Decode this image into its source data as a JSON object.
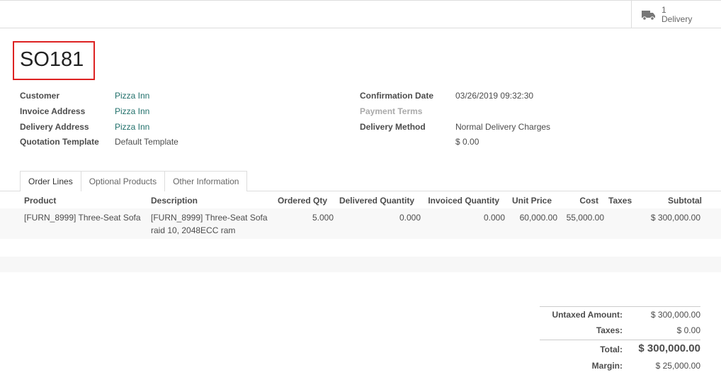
{
  "smart_button": {
    "count": "1",
    "label": "Delivery",
    "icon": "truck-icon"
  },
  "title": "SO181",
  "fields_left": [
    {
      "label": "Customer",
      "value": "Pizza Inn"
    },
    {
      "label": "Invoice Address",
      "value": "Pizza Inn"
    },
    {
      "label": "Delivery Address",
      "value": "Pizza Inn"
    },
    {
      "label": "Quotation Template",
      "value": "Default Template"
    }
  ],
  "fields_right": [
    {
      "label": "Confirmation Date",
      "value": "03/26/2019 09:32:30"
    },
    {
      "label": "Payment Terms",
      "value": ""
    },
    {
      "label": "Delivery Method",
      "value": "Normal Delivery Charges"
    },
    {
      "label": "",
      "value": "$ 0.00"
    }
  ],
  "tabs": [
    "Order Lines",
    "Optional Products",
    "Other Information"
  ],
  "columns": [
    "Product",
    "Description",
    "Ordered Qty",
    "Delivered Quantity",
    "Invoiced Quantity",
    "Unit Price",
    "Cost",
    "Taxes",
    "Subtotal"
  ],
  "rows": [
    {
      "product": "[FURN_8999] Three-Seat Sofa",
      "description": "[FURN_8999] Three-Seat Sofa",
      "description2": "raid 10, 2048ECC ram",
      "ordered": "5.000",
      "delivered": "0.000",
      "invoiced": "0.000",
      "unit_price": "60,000.00",
      "cost": "55,000.00",
      "taxes": "",
      "subtotal": "$ 300,000.00"
    }
  ],
  "totals": {
    "untaxed_label": "Untaxed Amount:",
    "untaxed": "$ 300,000.00",
    "taxes_label": "Taxes:",
    "taxes": "$ 0.00",
    "total_label": "Total:",
    "total": "$ 300,000.00",
    "margin_label": "Margin:",
    "margin": "$ 25,000.00"
  }
}
